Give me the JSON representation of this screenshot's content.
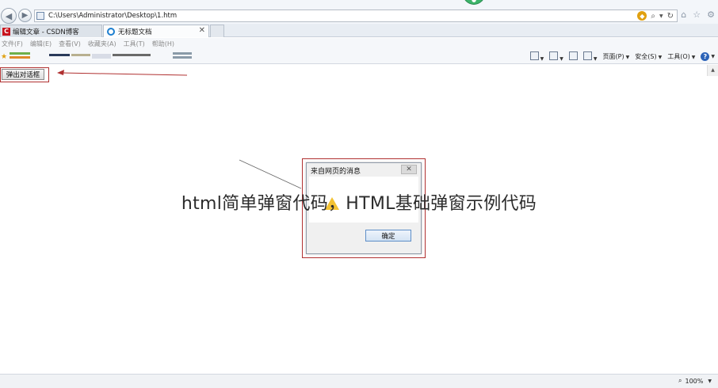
{
  "address_bar": {
    "url": "C:\\Users\\Administrator\\Desktop\\1.htm"
  },
  "tabs": [
    {
      "label": "编辑文章 - CSDN博客"
    },
    {
      "label": "无标题文档"
    }
  ],
  "menu": [
    "文件(F)",
    "编辑(E)",
    "查看(V)",
    "收藏夹(A)",
    "工具(T)",
    "帮助(H)"
  ],
  "command_bar": {
    "page_label": "页面(P)",
    "safety_label": "安全(S)",
    "tools_label": "工具(O)"
  },
  "page": {
    "popup_button_label": "弹出对话框"
  },
  "dialog": {
    "title": "来自网页的消息",
    "ok_label": "确定"
  },
  "watermark": {
    "text": "html简单弹窗代码，HTML基础弹窗示例代码"
  },
  "status_bar": {
    "zoom": "100%"
  },
  "colors": {
    "highlight_red": "#b03030",
    "csdn_red": "#c8141e",
    "ie_blue": "#1d7fd0"
  }
}
